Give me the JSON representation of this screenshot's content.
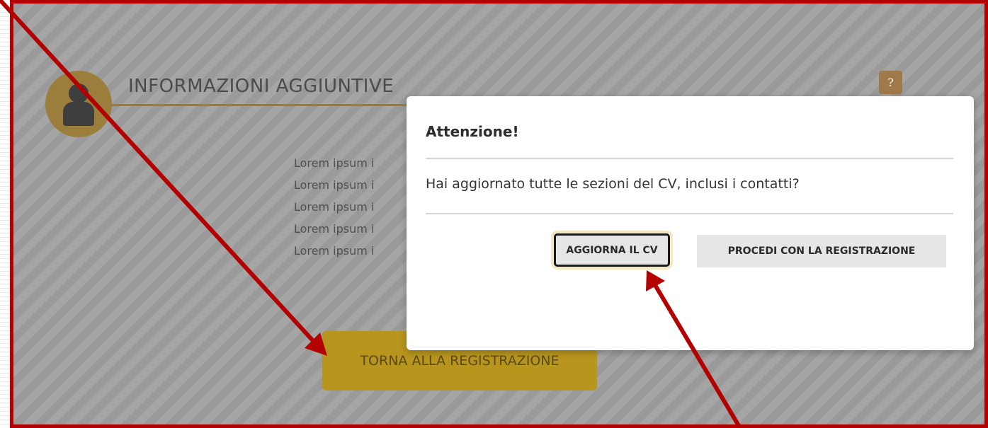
{
  "section": {
    "title": "INFORMAZIONI AGGIUNTIVE",
    "help_label": "?",
    "lorem_lines": [
      "Lorem ipsum i",
      "Lorem ipsum i",
      "Lorem ipsum i",
      "Lorem ipsum i",
      "Lorem ipsum i"
    ],
    "back_button": "TORNA ALLA REGISTRAZIONE"
  },
  "modal": {
    "title": "Attenzione!",
    "message": "Hai aggiornato tutte le sezioni del CV, inclusi i contatti?",
    "buttons": {
      "update": "AGGIORNA IL CV",
      "proceed": "PROCEDI CON LA REGISTRAZIONE"
    }
  },
  "colors": {
    "annotation": "#b30000",
    "accent_gold": "#b8951d",
    "avatar_brown": "#9b7e3c"
  },
  "icons": {
    "avatar": "user-icon",
    "help": "question-icon"
  }
}
